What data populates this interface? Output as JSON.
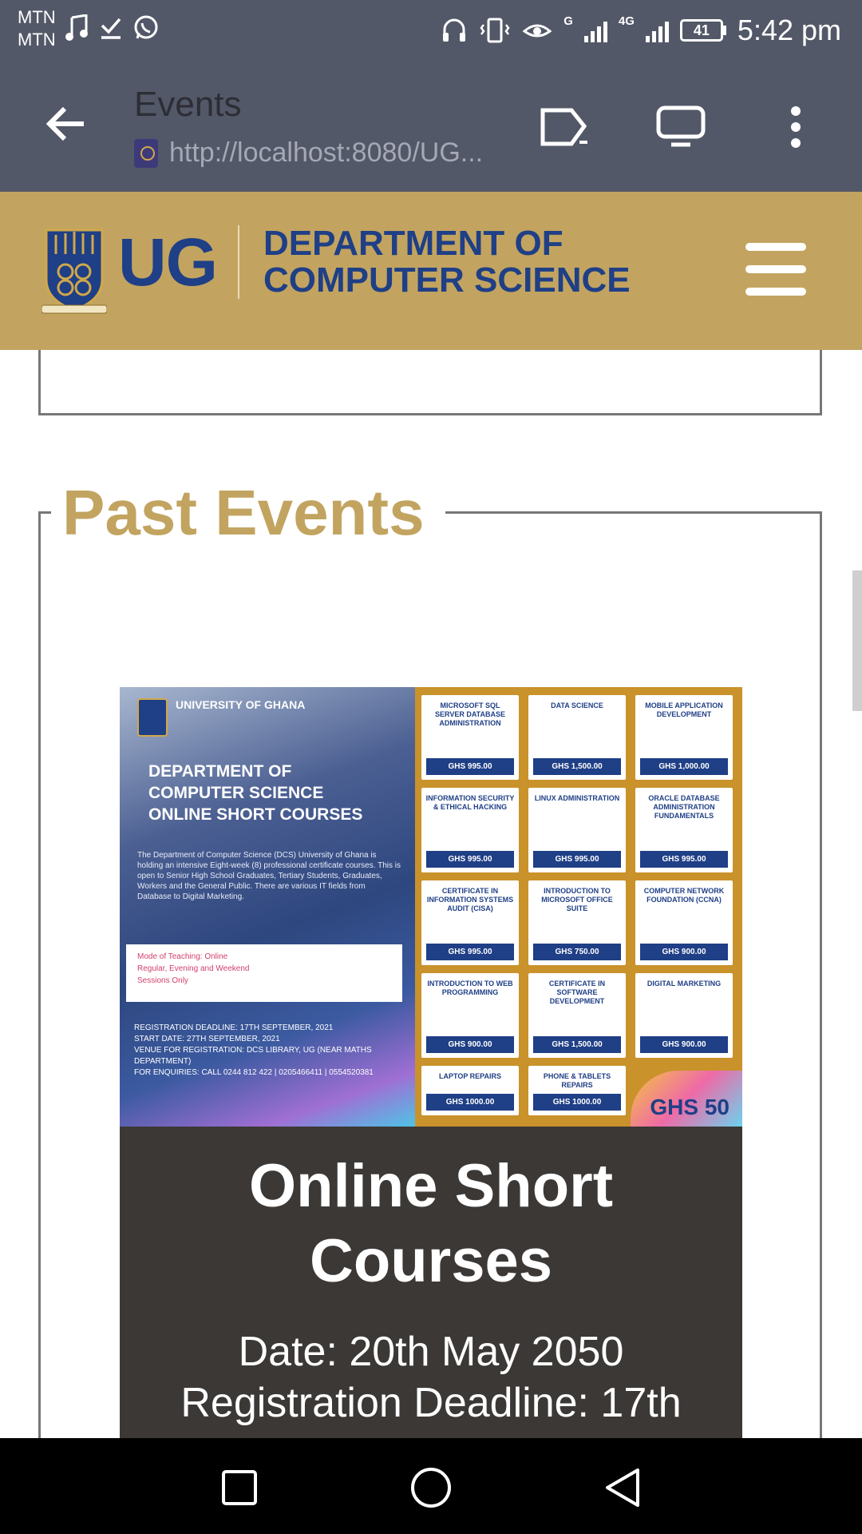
{
  "status_bar": {
    "carrier_1": "MTN",
    "carrier_2": "MTN",
    "network_label_1": "G",
    "network_label_2": "4G",
    "battery": "41",
    "time": "5:42 pm"
  },
  "browser": {
    "page_title": "Events",
    "url": "http://localhost:8080/UG..."
  },
  "site_header": {
    "logo_text": "UG",
    "dept_line_1": "DEPARTMENT OF",
    "dept_line_2": "COMPUTER SCIENCE"
  },
  "section": {
    "legend": "Past Events"
  },
  "event": {
    "poster": {
      "university": "UNIVERSITY OF GHANA",
      "title_1": "DEPARTMENT OF",
      "title_2": "COMPUTER SCIENCE",
      "title_3": "ONLINE SHORT COURSES",
      "description": "The Department of Computer Science (DCS) University of Ghana is holding an intensive Eight-week (8) professional certificate courses. This is open to Senior High School Graduates, Tertiary Students, Graduates, Workers and the General Public. There are various IT fields from Database to Digital Marketing.",
      "mode_line_1": "Mode of Teaching: Online",
      "mode_line_2": "Regular, Evening and Weekend",
      "mode_line_3": "Sessions Only",
      "deadline_line": "REGISTRATION DEADLINE: 17TH SEPTEMBER, 2021",
      "start_line": "START DATE: 27TH SEPTEMBER, 2021",
      "venue_line": "VENUE FOR REGISTRATION: DCS LIBRARY, UG (NEAR MATHS DEPARTMENT)",
      "enquiries_line": "FOR ENQUIRIES: CALL 0244 812 422 | 0205466411 | 0554520381",
      "courses": [
        {
          "name": "MICROSOFT SQL SERVER DATABASE ADMINISTRATION",
          "price": "GHS 995.00"
        },
        {
          "name": "DATA SCIENCE",
          "price": "GHS 1,500.00"
        },
        {
          "name": "MOBILE APPLICATION DEVELOPMENT",
          "price": "GHS 1,000.00"
        },
        {
          "name": "INFORMATION SECURITY & ETHICAL HACKING",
          "price": "GHS 995.00"
        },
        {
          "name": "LINUX ADMINISTRATION",
          "price": "GHS 995.00"
        },
        {
          "name": "ORACLE DATABASE ADMINISTRATION FUNDAMENTALS",
          "price": "GHS 995.00"
        },
        {
          "name": "CERTIFICATE IN INFORMATION SYSTEMS AUDIT (CISA)",
          "price": "GHS 995.00"
        },
        {
          "name": "INTRODUCTION TO MICROSOFT OFFICE SUITE",
          "price": "GHS 750.00"
        },
        {
          "name": "COMPUTER NETWORK FOUNDATION (CCNA)",
          "price": "GHS 900.00"
        },
        {
          "name": "INTRODUCTION TO WEB PROGRAMMING",
          "price": "GHS 900.00"
        },
        {
          "name": "CERTIFICATE IN SOFTWARE DEVELOPMENT",
          "price": "GHS 1,500.00"
        },
        {
          "name": "DIGITAL MARKETING",
          "price": "GHS 900.00"
        },
        {
          "name": "LAPTOP REPAIRS",
          "price": "GHS 1000.00"
        },
        {
          "name": "PHONE & TABLETS REPAIRS",
          "price": "GHS 1000.00"
        }
      ],
      "badge": "GHS 50"
    },
    "title": "Online Short Courses",
    "date": "Date: 20th May 2050",
    "deadline": "Registration Deadline: 17th"
  },
  "colors": {
    "status_bar": "#535868",
    "header_gold": "#c2a460",
    "brand_blue": "#1f3f86",
    "card_dark": "#3b3836"
  },
  "icons": {
    "back": "back-arrow-icon",
    "cast": "cast-icon",
    "desktop": "desktop-site-icon",
    "more": "more-vert-icon",
    "menu": "hamburger-menu-icon",
    "nav_recent": "square-icon",
    "nav_home": "circle-icon",
    "nav_back": "triangle-icon"
  }
}
